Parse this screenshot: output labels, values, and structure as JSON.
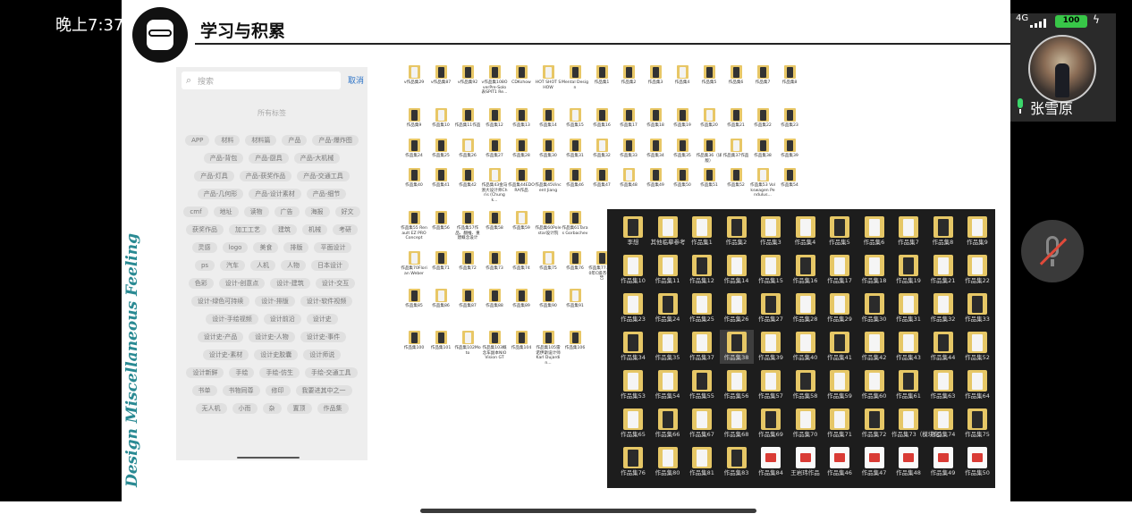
{
  "status": {
    "time": "晚上7:37",
    "network": "4G",
    "battery": "100"
  },
  "slide": {
    "title": "学习与积累",
    "side_text": "Design Miscellaneous Feeling"
  },
  "tag_panel": {
    "search_placeholder": "搜索",
    "cancel": "取消",
    "all_tags": "所有标签",
    "tags": [
      "APP",
      "材料",
      "材料篇",
      "产品",
      "产品-爆炸图",
      "产品-背包",
      "产品-厨具",
      "产品-大机械",
      "产品-灯具",
      "产品-获奖作品",
      "产品-交通工具",
      "产品-几何形",
      "产品-设计素材",
      "产品-细节",
      "cmf",
      "地址",
      "读物",
      "广告",
      "海报",
      "好文",
      "获奖作品",
      "加工工艺",
      "建筑",
      "机械",
      "考研",
      "灵感",
      "logo",
      "美食",
      "排版",
      "平面设计",
      "ps",
      "汽车",
      "人机",
      "人物",
      "日本设计",
      "色彩",
      "设计-创意点",
      "设计-建筑",
      "设计-交互",
      "设计-绿色可持续",
      "设计-排版",
      "设计-软件视频",
      "设计-手绘视频",
      "设计前沿",
      "设计史",
      "设计史-产品",
      "设计史-人物",
      "设计史-事件",
      "设计史-素材",
      "设计史胶囊",
      "设计师说",
      "设计新鲜",
      "手绘",
      "手绘-仿生",
      "手绘-交通工具",
      "书单",
      "书物同尊",
      "修印",
      "我要进其中之一",
      "无人机",
      "小而",
      "杂",
      "置顶",
      "作品集"
    ]
  },
  "light_files": [
    [
      "v作品集29",
      "v作品集87",
      "v作品集92",
      "v作品集108OverPre-Solo 表SPIT1 Re...",
      "CDKshow",
      "HOT SHOT SHOW",
      "Mental Design",
      "作品集1",
      "作品集2",
      "作品集3",
      "作品集4",
      "作品集5",
      "作品集6",
      "作品集7",
      "作品集8"
    ],
    [
      "作品集9",
      "作品集10",
      "作品集11作品",
      "作品集12",
      "作品集13",
      "作品集14",
      "作品集15",
      "作品集16",
      "作品集17",
      "作品集18",
      "作品集19",
      "作品集20",
      "作品集21",
      "作品集22",
      "作品集23"
    ],
    [
      "作品集24",
      "作品集25",
      "作品集26",
      "作品集27",
      "作品集28",
      "作品集30",
      "作品集31",
      "作品集32",
      "作品集33",
      "作品集34",
      "作品集35",
      "作品集36（详版）",
      "作品集37作品",
      "作品集38",
      "作品集39"
    ],
    [
      "作品集40",
      "作品集41",
      "作品集42",
      "作品集43金马浙大设计师Chris (Chung k...",
      "作品集44EDORA作品",
      "作品集45Vincent Jiang",
      "作品集46",
      "作品集47",
      "作品集48",
      "作品集49",
      "作品集50",
      "作品集51",
      "作品集52",
      "作品集53 Volkswagen Pendulus...",
      "作品集54"
    ],
    [
      "作品集55 Renault EZ PRO Concept",
      "作品集56",
      "作品集57作品、翻推、重建概念设计",
      "作品集58",
      "作品集59",
      "作品集60Polestar设计院",
      "作品集61Taras Gorbachev",
      "",
      "",
      "",
      "",
      "",
      "",
      "",
      ""
    ],
    [
      "作品集70Florian Weber",
      "作品集71",
      "作品集72",
      "作品集73",
      "作品集74",
      "作品集75",
      "作品集76",
      "作品集77.2020年C级杰作报告",
      "",
      "",
      "",
      "",
      "",
      "",
      ""
    ],
    [
      "作品集85",
      "作品集86",
      "作品集87",
      "作品集88",
      "作品集89",
      "作品集90",
      "作品集91",
      "",
      "",
      "",
      "",
      "",
      "",
      "",
      ""
    ],
    [
      "作品集100",
      "作品集101",
      "作品集102Moto",
      "作品集103概念车副本NIO Vision GT",
      "作品集104",
      "作品集105雷诺伊斯设计师Karl Dujardin...",
      "作品集106",
      "",
      "",
      "",
      "",
      "",
      "",
      "",
      ""
    ]
  ],
  "dark_files": [
    [
      "李想",
      "其他临摹参考",
      "作品集1",
      "作品集2",
      "作品集3",
      "作品集4",
      "作品集5",
      "作品集6",
      "作品集7",
      "作品集8",
      "作品集9"
    ],
    [
      "作品集10",
      "作品集11",
      "作品集12",
      "作品集14",
      "作品集15",
      "作品集16",
      "作品集17",
      "作品集18",
      "作品集19",
      "作品集21",
      "作品集22"
    ],
    [
      "作品集23",
      "作品集24",
      "作品集25",
      "作品集26",
      "作品集27",
      "作品集28",
      "作品集29",
      "作品集30",
      "作品集31",
      "作品集32",
      "作品集33"
    ],
    [
      "作品集34",
      "作品集35",
      "作品集37",
      "作品集38",
      "作品集39",
      "作品集40",
      "作品集41",
      "作品集42",
      "作品集43",
      "作品集44",
      "作品集52"
    ],
    [
      "作品集53",
      "作品集54",
      "作品集55",
      "作品集56",
      "作品集57",
      "作品集58",
      "作品集59",
      "作品集60",
      "作品集61",
      "作品集63",
      "作品集64"
    ],
    [
      "作品集65",
      "作品集66",
      "作品集67",
      "作品集68",
      "作品集69",
      "作品集70",
      "作品集71",
      "作品集72",
      "作品集73（模块化）",
      "作品集74",
      "作品集75"
    ],
    [
      "作品集76",
      "作品集80",
      "作品集81",
      "作品集83",
      "作品集84",
      "王岩玮作品",
      "作品集46",
      "作品集47",
      "作品集48",
      "作品集49",
      "作品集50"
    ]
  ],
  "participant": {
    "name": "张雪原"
  }
}
